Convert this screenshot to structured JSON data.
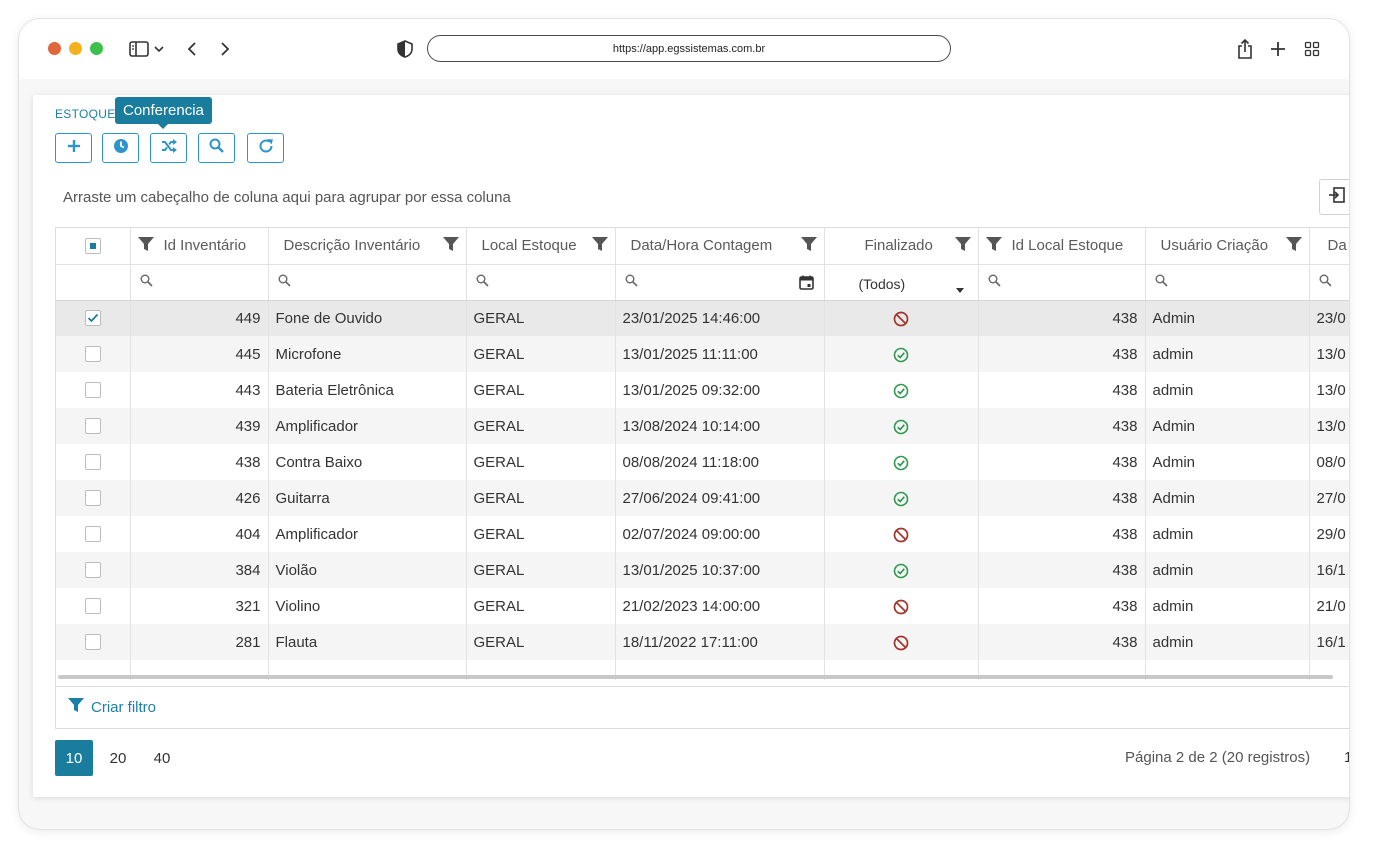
{
  "browser": {
    "url": "https://app.egssistemas.com.br",
    "traffic_lights": [
      "#e0663a",
      "#f2b21f",
      "#3cbf4b"
    ]
  },
  "page": {
    "breadcrumb": "ESTOQUE",
    "tooltip": "Conferencia",
    "toolbar": [
      {
        "name": "add-button",
        "icon": "plus-icon"
      },
      {
        "name": "history-button",
        "icon": "clock-icon"
      },
      {
        "name": "conferencia-button",
        "icon": "shuffle-icon"
      },
      {
        "name": "search-button",
        "icon": "search-icon"
      },
      {
        "name": "refresh-button",
        "icon": "refresh-icon"
      }
    ],
    "group_hint": "Arraste um cabeçalho de coluna aqui para agrupar por essa coluna",
    "accent_color": "#1b7d9e"
  },
  "grid": {
    "columns": [
      {
        "label": "Id Inventário",
        "filter_icon": "left"
      },
      {
        "label": "Descrição Inventário",
        "filter_icon": "right"
      },
      {
        "label": "Local Estoque",
        "filter_icon": "right"
      },
      {
        "label": "Data/Hora Contagem",
        "filter_icon": "right"
      },
      {
        "label": "Finalizado",
        "filter_icon": "right"
      },
      {
        "label": "Id Local Estoque",
        "filter_icon": "left"
      },
      {
        "label": "Usuário Criação",
        "filter_icon": "right"
      },
      {
        "label": "Da",
        "filter_icon": "none"
      }
    ],
    "finalizado_filter": "(Todos)",
    "rows": [
      {
        "checked": true,
        "id": "449",
        "desc": "Fone de Ouvido",
        "local": "GERAL",
        "data": "23/01/2025 14:46:00",
        "finalizado": false,
        "id_local": "438",
        "usuario": "Admin",
        "da": "23/0"
      },
      {
        "checked": false,
        "id": "445",
        "desc": "Microfone",
        "local": "GERAL",
        "data": "13/01/2025 11:11:00",
        "finalizado": true,
        "id_local": "438",
        "usuario": "admin",
        "da": "13/0"
      },
      {
        "checked": false,
        "id": "443",
        "desc": "Bateria Eletrônica",
        "local": "GERAL",
        "data": "13/01/2025 09:32:00",
        "finalizado": true,
        "id_local": "438",
        "usuario": "admin",
        "da": "13/0"
      },
      {
        "checked": false,
        "id": "439",
        "desc": "Amplificador",
        "local": "GERAL",
        "data": "13/08/2024 10:14:00",
        "finalizado": true,
        "id_local": "438",
        "usuario": "Admin",
        "da": "13/0"
      },
      {
        "checked": false,
        "id": "438",
        "desc": "Contra Baixo",
        "local": "GERAL",
        "data": "08/08/2024 11:18:00",
        "finalizado": true,
        "id_local": "438",
        "usuario": "Admin",
        "da": "08/0"
      },
      {
        "checked": false,
        "id": "426",
        "desc": "Guitarra",
        "local": "GERAL",
        "data": "27/06/2024 09:41:00",
        "finalizado": true,
        "id_local": "438",
        "usuario": "Admin",
        "da": "27/0"
      },
      {
        "checked": false,
        "id": "404",
        "desc": "Amplificador",
        "local": "GERAL",
        "data": "02/07/2024 09:00:00",
        "finalizado": false,
        "id_local": "438",
        "usuario": "admin",
        "da": "29/0"
      },
      {
        "checked": false,
        "id": "384",
        "desc": "Violão",
        "local": "GERAL",
        "data": "13/01/2025 10:37:00",
        "finalizado": true,
        "id_local": "438",
        "usuario": "admin",
        "da": "16/1"
      },
      {
        "checked": false,
        "id": "321",
        "desc": "Violino",
        "local": "GERAL",
        "data": "21/02/2023 14:00:00",
        "finalizado": false,
        "id_local": "438",
        "usuario": "admin",
        "da": "21/0"
      },
      {
        "checked": false,
        "id": "281",
        "desc": "Flauta",
        "local": "GERAL",
        "data": "18/11/2022 17:11:00",
        "finalizado": false,
        "id_local": "438",
        "usuario": "admin",
        "da": "16/1"
      }
    ],
    "status_colors": {
      "finalizado": "#2e9a4f",
      "nao_finalizado": "#a3352a"
    }
  },
  "footer": {
    "create_filter": "Criar filtro",
    "page_sizes": [
      "10",
      "20",
      "40"
    ],
    "active_page_size": "10",
    "page_info": "Página 2 de 2 (20 registros)",
    "next_page": "1"
  }
}
